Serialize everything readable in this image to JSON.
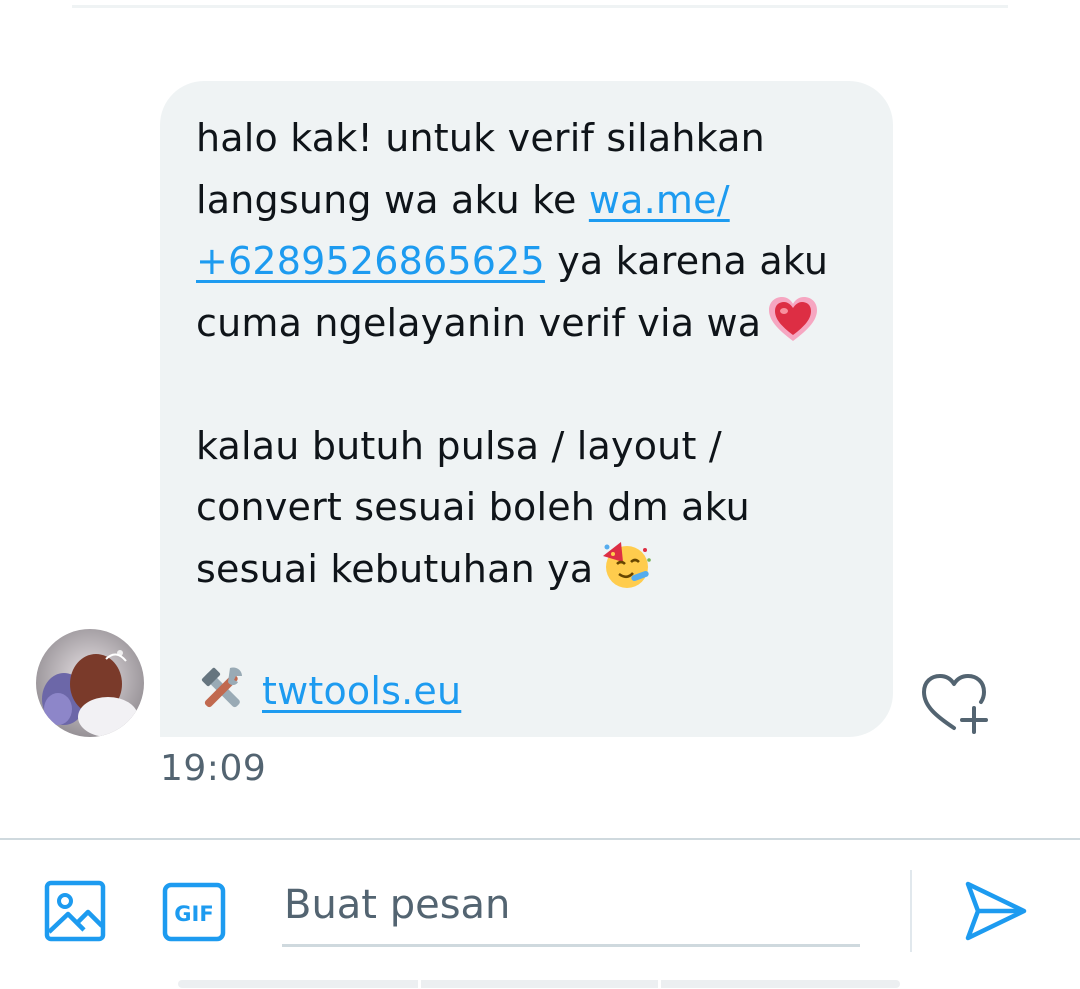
{
  "message": {
    "lines": [
      "halo kak! untuk verif silahkan",
      "langsung wa aku ke ",
      "wa.me/",
      "+6289526865625",
      " ya karena aku",
      "cuma ngelayanin verif via wa",
      "kalau butuh pulsa / layout /",
      "convert sesuai boleh dm aku",
      "sesuai kebutuhan ya",
      "twtools.eu"
    ],
    "timestamp": "19:09",
    "sender_avatar": "avatar-photo",
    "emojis": [
      "beating-heart-emoji",
      "partying-face-emoji",
      "hammer-and-wrench-emoji"
    ]
  },
  "composer": {
    "placeholder": "Buat pesan",
    "gif_label": "GIF",
    "icons": [
      "image-icon",
      "gif-icon",
      "send-icon"
    ]
  },
  "colors": {
    "bubble_bg": "#eff3f4",
    "link": "#1d9bf0",
    "text": "#0f1419",
    "secondary_text": "#536471",
    "accent": "#1d9bf0"
  }
}
